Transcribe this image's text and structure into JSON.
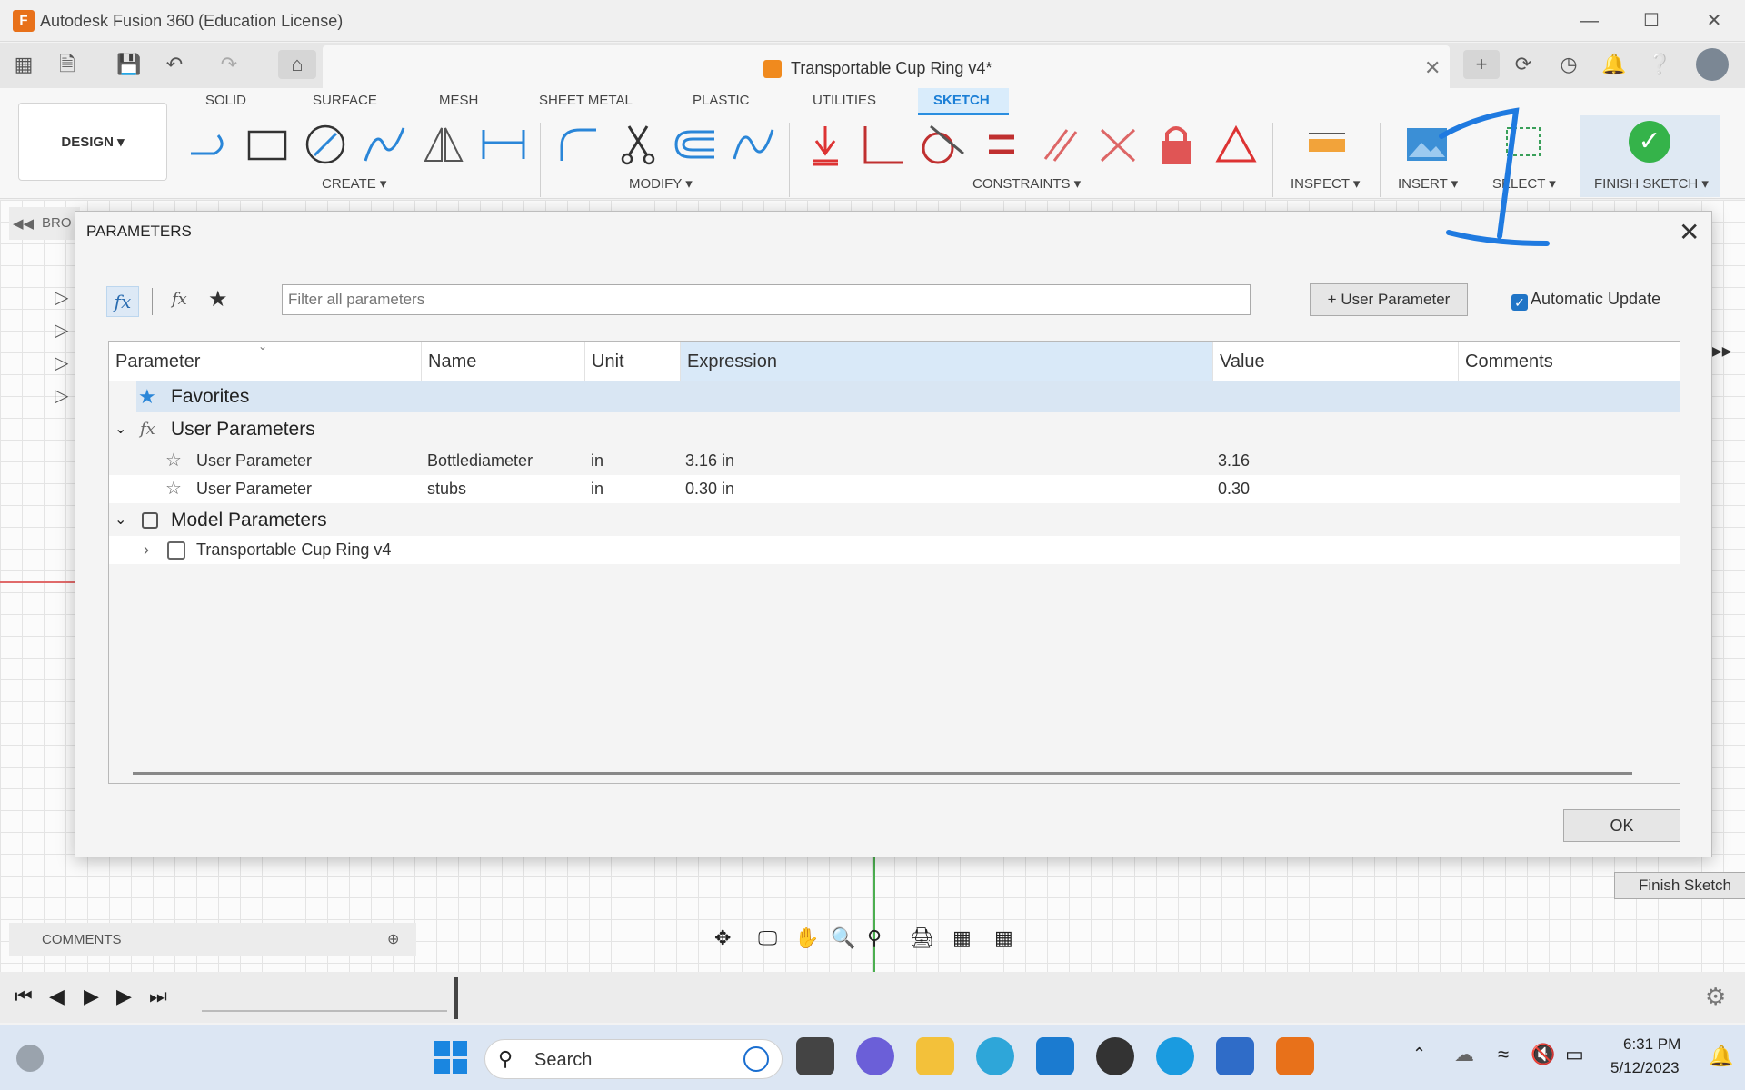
{
  "window": {
    "title": "Autodesk Fusion 360 (Education License)"
  },
  "document": {
    "title": "Transportable Cup Ring v4*"
  },
  "ribbon": {
    "workspace": "DESIGN",
    "tabs": [
      "SOLID",
      "SURFACE",
      "MESH",
      "SHEET METAL",
      "PLASTIC",
      "UTILITIES",
      "SKETCH"
    ],
    "active_tab": "SKETCH",
    "groups": {
      "create": "CREATE",
      "modify": "MODIFY",
      "constraints": "CONSTRAINTS",
      "inspect": "INSPECT",
      "insert": "INSERT",
      "select": "SELECT",
      "finish": "FINISH SKETCH"
    }
  },
  "browser": {
    "label": "BRO"
  },
  "dialog": {
    "title": "PARAMETERS",
    "filter_placeholder": "Filter all parameters",
    "add_user_parameter": "User Parameter",
    "automatic_update": "Automatic Update",
    "ok_label": "OK",
    "columns": [
      "Parameter",
      "Name",
      "Unit",
      "Expression",
      "Value",
      "Comments"
    ],
    "groups": {
      "favorites": "Favorites",
      "user_parameters": "User Parameters",
      "model_parameters": "Model Parameters"
    },
    "user_rows": [
      {
        "parameter": "User Parameter",
        "name": "Bottlediameter",
        "unit": "in",
        "expression": "3.16 in",
        "value": "3.16",
        "comment": ""
      },
      {
        "parameter": "User Parameter",
        "name": "stubs",
        "unit": "in",
        "expression": "0.30 in",
        "value": "0.30",
        "comment": ""
      }
    ],
    "model_rows": [
      {
        "parameter": "Transportable Cup Ring v4"
      }
    ]
  },
  "canvas": {
    "finish_sketch": "Finish Sketch"
  },
  "comments": {
    "label": "COMMENTS"
  },
  "taskbar": {
    "search": "Search",
    "time": "6:31 PM",
    "date": "5/12/2023"
  }
}
